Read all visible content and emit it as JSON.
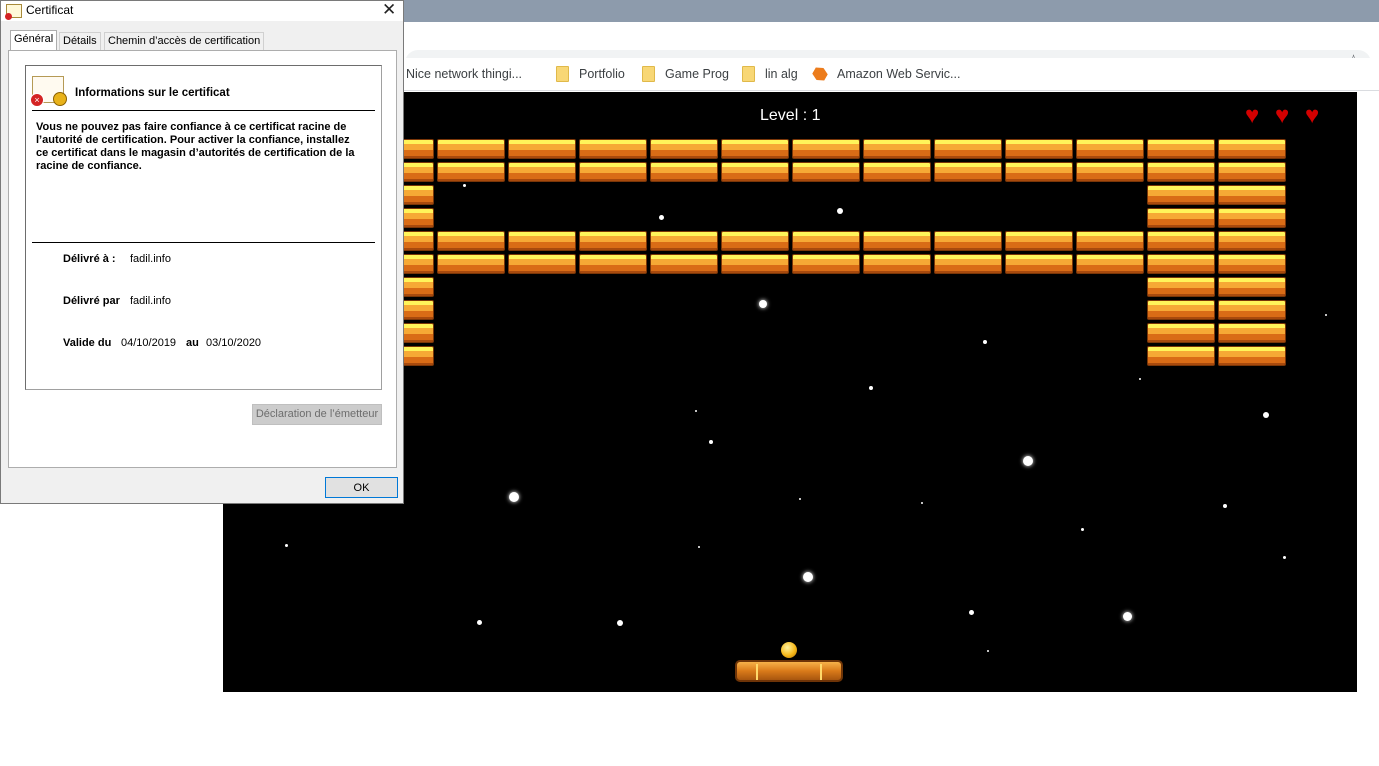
{
  "browser": {
    "bookmarks": [
      {
        "label": "Nice network thingi...",
        "icon": "folder-icon"
      },
      {
        "label": "Portfolio",
        "icon": "folder-icon"
      },
      {
        "label": "Game Prog",
        "icon": "folder-icon"
      },
      {
        "label": "lin alg",
        "icon": "folder-icon"
      },
      {
        "label": "Amazon Web Servic...",
        "icon": "aws-icon"
      }
    ]
  },
  "game": {
    "level_text": "Level : 1",
    "lives": 3,
    "colors": {
      "background": "#000000",
      "heart": "#d40000",
      "brick": "#f6a935"
    }
  },
  "dialog": {
    "title": "Certificat",
    "tabs": [
      "Général",
      "Détails",
      "Chemin d’accès de certification"
    ],
    "active_tab": "Général",
    "info_title": "Informations sur le certificat",
    "warning": "Vous ne pouvez pas faire confiance à ce certificat racine de l’autorité de certification. Pour activer la confiance, installez ce certificat dans le magasin d’autorités de certification de la racine de confiance.",
    "issued_to_label": "Délivré à :",
    "issued_to_value": "fadil.info",
    "issued_by_label": "Délivré par",
    "issued_by_value": "fadil.info",
    "valid_label": "Valide du",
    "valid_from": "04/10/2019",
    "valid_to_label": "au",
    "valid_to": "03/10/2020",
    "issuer_statement_button": "Déclaration de l’émetteur",
    "ok_button": "OK"
  }
}
